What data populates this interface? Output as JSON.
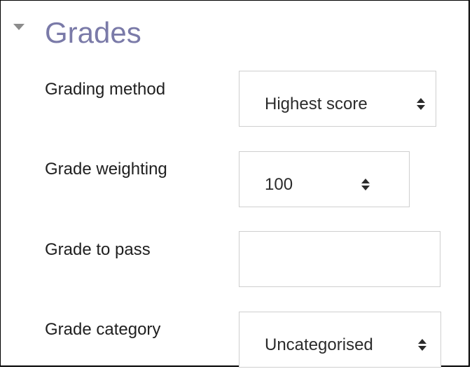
{
  "section": {
    "title": "Grades",
    "toggle_icon": "collapse-triangle-icon"
  },
  "fields": {
    "grading_method": {
      "label": "Grading method",
      "selected": "Highest score",
      "icon": "select-arrows-icon"
    },
    "grade_weighting": {
      "label": "Grade weighting",
      "selected": "100",
      "icon": "select-arrows-icon"
    },
    "grade_to_pass": {
      "label": "Grade to pass",
      "value": ""
    },
    "grade_category": {
      "label": "Grade category",
      "selected": "Uncategorised",
      "icon": "select-arrows-icon"
    }
  },
  "colors": {
    "title": "#7a7aa8",
    "label": "#1f1f1f",
    "control_border": "#cfcfcf",
    "toggle": "#8c8c8c"
  }
}
